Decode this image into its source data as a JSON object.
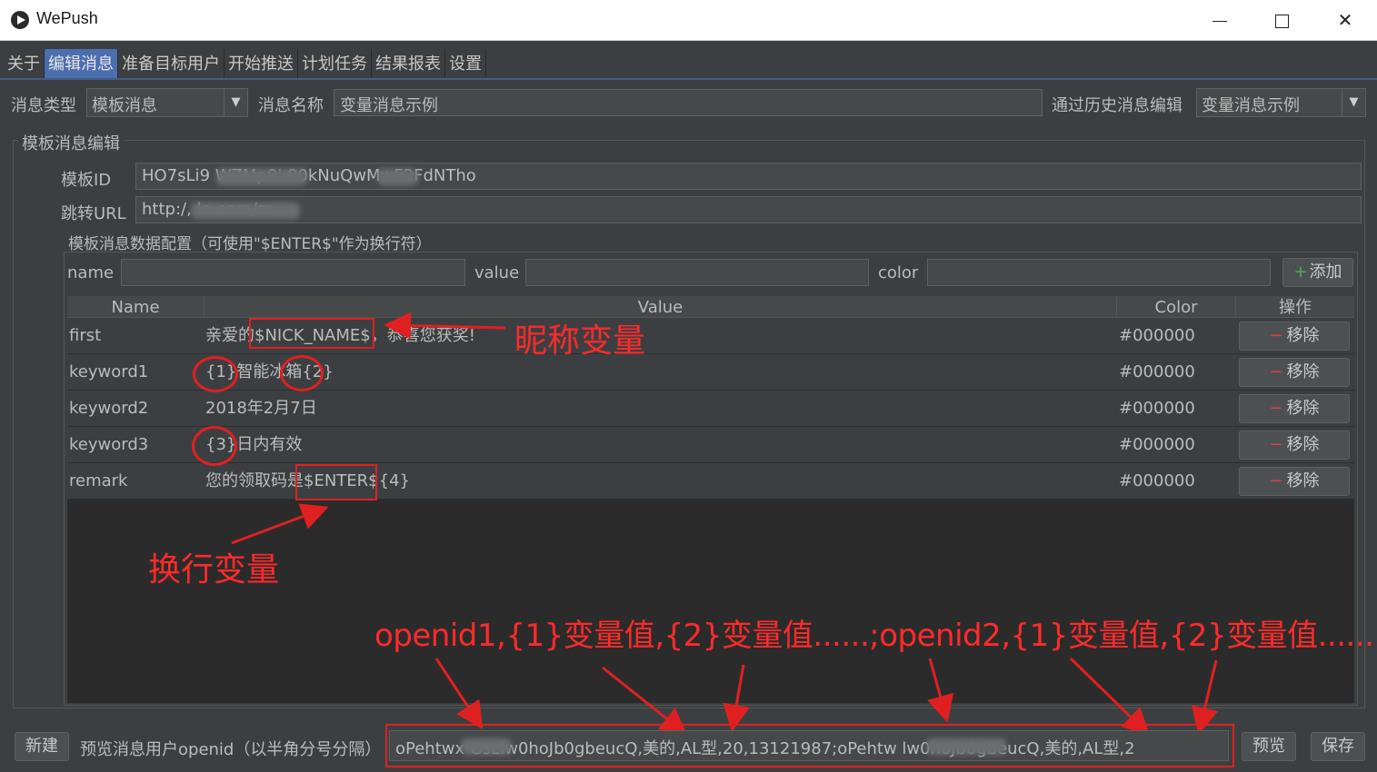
{
  "window": {
    "title": "WePush",
    "minimize_icon": "minimize-icon",
    "maximize_icon": "maximize-icon",
    "close_glyph": "✕"
  },
  "tabs": [
    "关于",
    "编辑消息",
    "准备目标用户",
    "开始推送",
    "计划任务",
    "结果报表",
    "设置"
  ],
  "active_tab": "编辑消息",
  "top_row": {
    "msg_type_label": "消息类型",
    "msg_type_value": "模板消息",
    "msg_name_label": "消息名称",
    "msg_name_value": "变量消息示例",
    "history_label": "通过历史消息编辑",
    "history_value": "变量消息示例"
  },
  "template_panel": {
    "title": "模板消息编辑",
    "template_id_label": "模板ID",
    "template_id_value": "HO7sLi9           WZMp0'       80kNuQwMwF2FdNTho",
    "url_label": "跳转URL",
    "url_value": "http:/,                         le.com/m",
    "data_config_title": "模板消息数据配置（可使用\"$ENTER$\"作为换行符）",
    "name_label": "name",
    "value_label": "value",
    "color_label": "color",
    "add_button": "添加"
  },
  "table": {
    "headers": [
      "Name",
      "Value",
      "Color",
      "操作"
    ],
    "rows": [
      {
        "name": "first",
        "value": "亲爱的$NICK_NAME$，恭喜您获奖!",
        "color": "#000000",
        "action": "移除"
      },
      {
        "name": "keyword1",
        "value": "{1}智能冰箱{2}",
        "color": "#000000",
        "action": "移除"
      },
      {
        "name": "keyword2",
        "value": "2018年2月7日",
        "color": "#000000",
        "action": "移除"
      },
      {
        "name": "keyword3",
        "value": "{3}日内有效",
        "color": "#000000",
        "action": "移除"
      },
      {
        "name": "remark",
        "value": "您的领取码是$ENTER${4}",
        "color": "#000000",
        "action": "移除"
      }
    ]
  },
  "annotations": {
    "nickname_var": "昵称变量",
    "newline_var": "换行变量",
    "openid_format": "openid1,{1}变量值,{2}变量值......;openid2,{1}变量值,{2}变量值......"
  },
  "bottom": {
    "new_button": "新建",
    "preview_label": "预览消息用户openid（以半角分号分隔）",
    "preview_value": "oPehtwx              GsLlw0hoJb0gbeucQ,美的,AL型,20,13121987;oPehtw                  lw0hoJb0gbeucQ,美的,AL型,2",
    "preview_button": "预览",
    "save_button": "保存"
  },
  "colors": {
    "background": "#3c3f41",
    "accent": "#4b6eaf",
    "annotation_red": "#e02020"
  }
}
